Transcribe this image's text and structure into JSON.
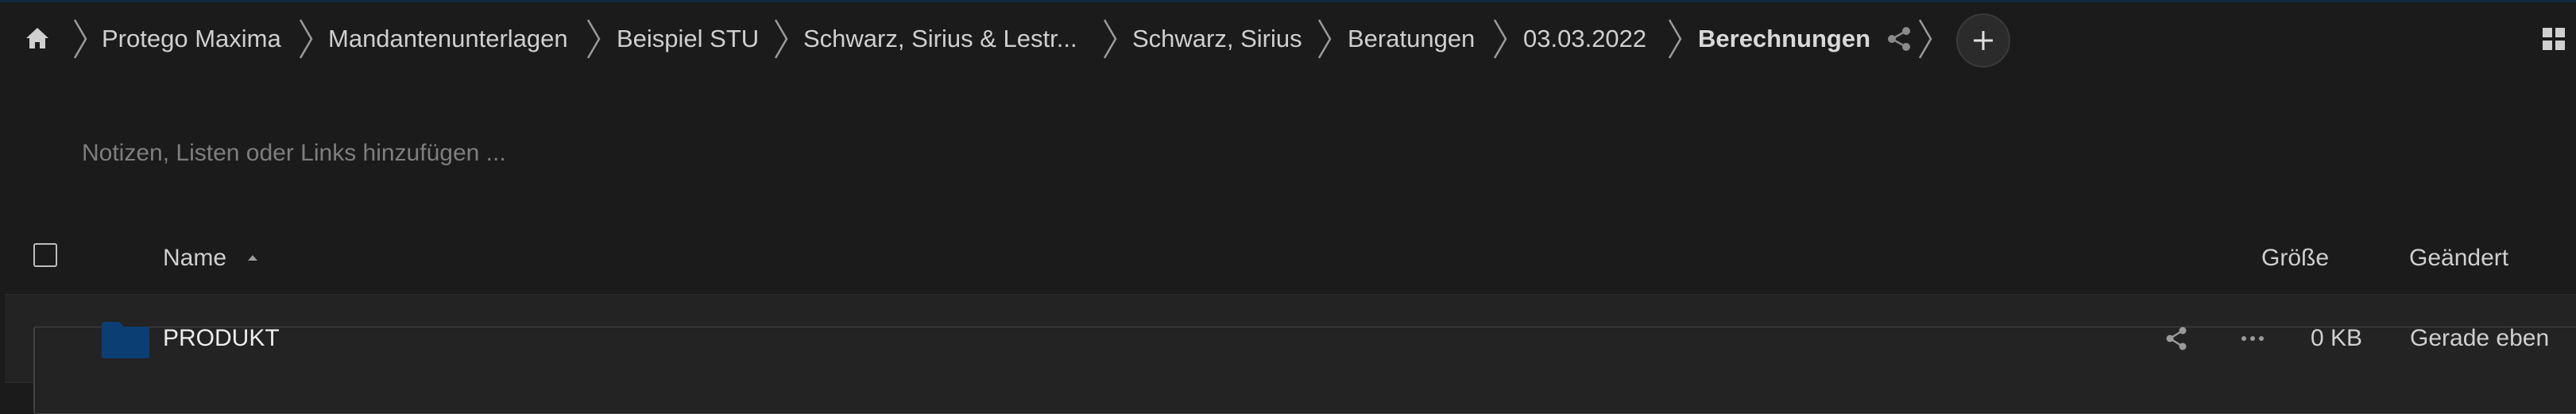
{
  "breadcrumb": {
    "items": [
      {
        "label": "Protego Maxima"
      },
      {
        "label": "Mandantenunterlagen"
      },
      {
        "label": "Beispiel STU"
      },
      {
        "label": "Schwarz, Sirius & Lestr..."
      },
      {
        "label": "Schwarz, Sirius"
      },
      {
        "label": "Beratungen"
      },
      {
        "label": "03.03.2022"
      },
      {
        "label": "Berechnungen"
      }
    ],
    "icons": {
      "home": "home-icon",
      "share": "share-icon",
      "add": "plus-icon",
      "grid": "grid-view-icon"
    }
  },
  "notes": {
    "placeholder": "Notizen, Listen oder Links hinzufügen ..."
  },
  "list": {
    "columns": {
      "name": "Name",
      "size": "Größe",
      "modified": "Geändert"
    },
    "sort": {
      "column": "name",
      "direction": "ascending"
    },
    "rows": [
      {
        "name": "PRODUKT",
        "size": "0 KB",
        "modified": "Gerade eben",
        "type": "folder"
      }
    ]
  },
  "colors": {
    "background": "#1b1b1b",
    "row_background": "#232323",
    "folder": "#0b3f73"
  }
}
